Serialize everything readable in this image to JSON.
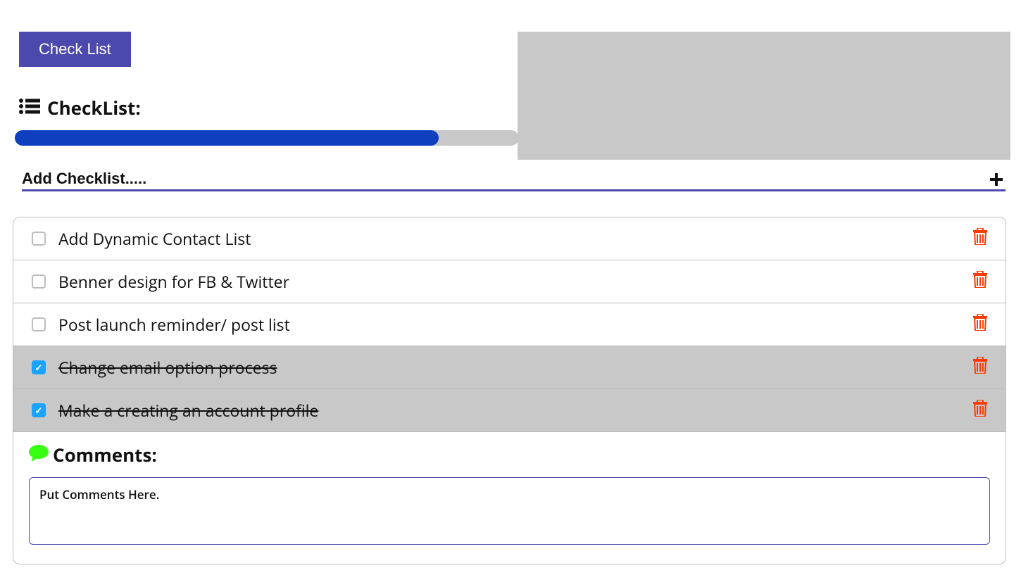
{
  "tab": {
    "label": "Check List"
  },
  "section": {
    "title": "CheckList:"
  },
  "progress": {
    "percent": 84
  },
  "add": {
    "placeholder": "Add Checklist....."
  },
  "items": [
    {
      "label": "Add Dynamic Contact List",
      "checked": false
    },
    {
      "label": "Benner design for FB & Twitter",
      "checked": false
    },
    {
      "label": "Post launch reminder/ post list",
      "checked": false
    },
    {
      "label": "Change email option process",
      "checked": true
    },
    {
      "label": "Make a creating an account profile",
      "checked": true
    }
  ],
  "comments": {
    "title": "Comments:",
    "placeholder": "Put Comments Here."
  },
  "colors": {
    "primary": "#4b49ac",
    "progress": "#0d3fbf",
    "trash": "#ff3b00",
    "comment_icon": "#39ff14"
  }
}
